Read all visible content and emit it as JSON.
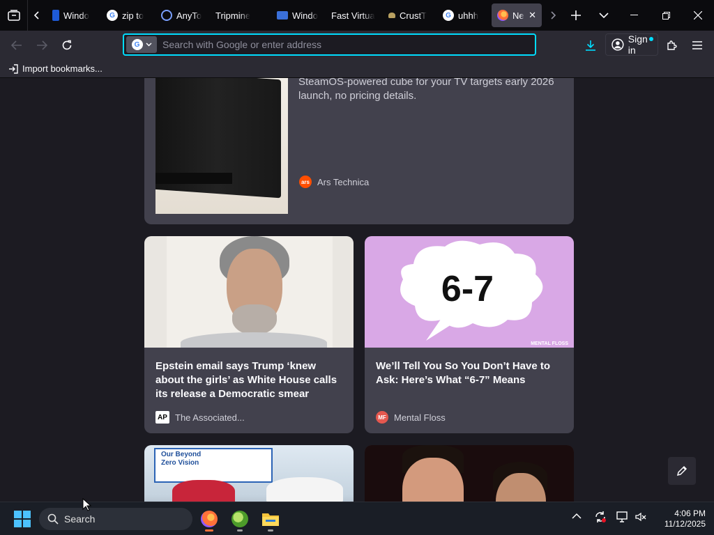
{
  "tabs": [
    {
      "label": "Windo",
      "favicon": "windows-icon"
    },
    {
      "label": "zip to",
      "favicon": "google-icon"
    },
    {
      "label": "AnyTo",
      "favicon": "anytoolbox-icon"
    },
    {
      "label": "Tripmine",
      "favicon": "none"
    },
    {
      "label": "Windo",
      "favicon": "pc-icon"
    },
    {
      "label": "Fast Virtua",
      "favicon": "none"
    },
    {
      "label": "CrustT",
      "favicon": "crust-icon"
    },
    {
      "label": "uhhh",
      "favicon": "google-icon"
    },
    {
      "label": "Ne",
      "favicon": "firefox-icon",
      "active": true
    }
  ],
  "urlbar": {
    "placeholder": "Search with Google or enter address",
    "value": ""
  },
  "toolbar": {
    "signin_label": "Sign in"
  },
  "bookmarks": {
    "import_label": "Import bookmarks..."
  },
  "stories": [
    {
      "title": "",
      "description": "SteamOS-powered cube for your TV targets early 2026 launch, no pricing details.",
      "source": "Ars Technica",
      "source_logo": "ars"
    },
    {
      "title": "Epstein email says Trump ‘knew about the girls’ as White House calls its release a Democratic smear",
      "source": "The Associated...",
      "source_logo": "AP"
    },
    {
      "title": "We’ll Tell You So You Don’t Have to Ask: Here’s What “6-7” Means",
      "source": "Mental Floss",
      "source_logo": "MF",
      "image_text": "6-7",
      "image_watermark": "MENTAL FLOSS"
    },
    {
      "image_text_lines": [
        "Our Beyond",
        "Zero Vision"
      ]
    }
  ],
  "taskbar": {
    "search_label": "Search",
    "time": "4:06 PM",
    "date": "11/12/2025"
  },
  "colors": {
    "accent": "#00ddff",
    "card": "#42414d",
    "page": "#1c1b22",
    "toolbar": "#2b2a33"
  }
}
